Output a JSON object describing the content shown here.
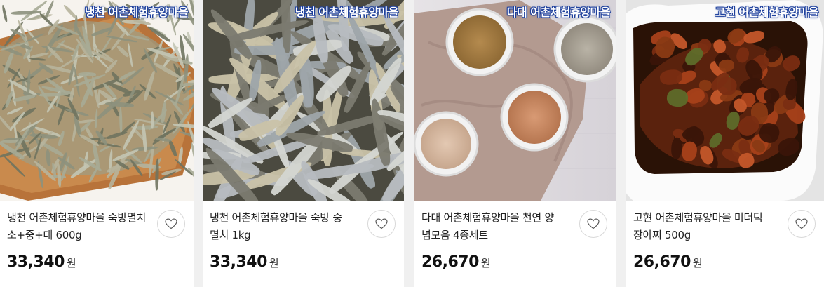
{
  "products": [
    {
      "badge": "냉천 어촌체험휴양마을",
      "title": "냉천 어촌체험휴양마을 죽방멸치 소+중+대 600g",
      "price": "33,340",
      "currency": "원",
      "image_icon": "anchovy-platter-photo"
    },
    {
      "badge": "냉천 어촌체험휴양마을",
      "title": "냉천 어촌체험휴양마을 죽방 중멸치 1kg",
      "price": "33,340",
      "currency": "원",
      "image_icon": "anchovy-closeup-photo"
    },
    {
      "badge": "다대 어촌체험휴양마을",
      "title": "다대 어촌체험휴양마을 천연 양념모음 4종세트",
      "price": "26,670",
      "currency": "원",
      "image_icon": "seasoning-bowls-photo"
    },
    {
      "badge": "고현 어촌체험휴양마을",
      "title": "고현 어촌체험휴양마을 미더덕 장아찌 500g",
      "price": "26,670",
      "currency": "원",
      "image_icon": "pickled-sea-squirt-photo"
    }
  ],
  "colors": {
    "badge_outline": "#1d3f9c",
    "card_bg": "#ffffff",
    "page_bg": "#f0f0f0"
  }
}
